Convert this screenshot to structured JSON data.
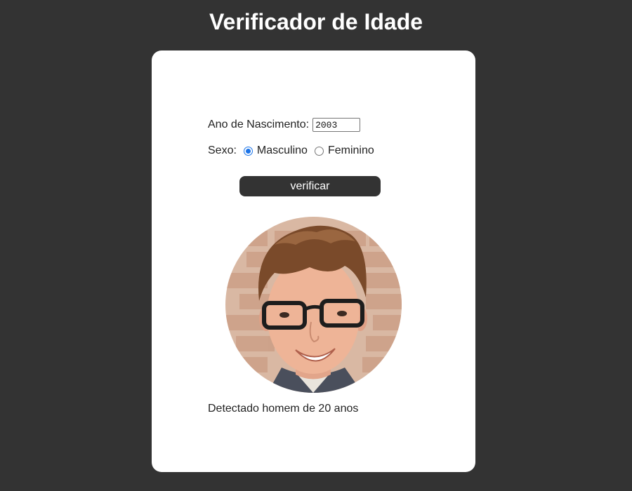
{
  "header": {
    "title": "Verificador de Idade"
  },
  "form": {
    "birth_year_label": "Ano de Nascimento:",
    "birth_year_value": "2003",
    "sex_label": "Sexo:",
    "sex_options": [
      {
        "label": "Masculino",
        "checked": true
      },
      {
        "label": "Feminino",
        "checked": false
      }
    ],
    "verify_button_label": "verificar"
  },
  "result": {
    "photo": "smiling-young-man-with-glasses",
    "text": "Detectado homem de 20 anos"
  },
  "colors": {
    "background": "#333333",
    "card": "#ffffff",
    "button": "#333333",
    "radio_accent": "#1a73e8"
  }
}
